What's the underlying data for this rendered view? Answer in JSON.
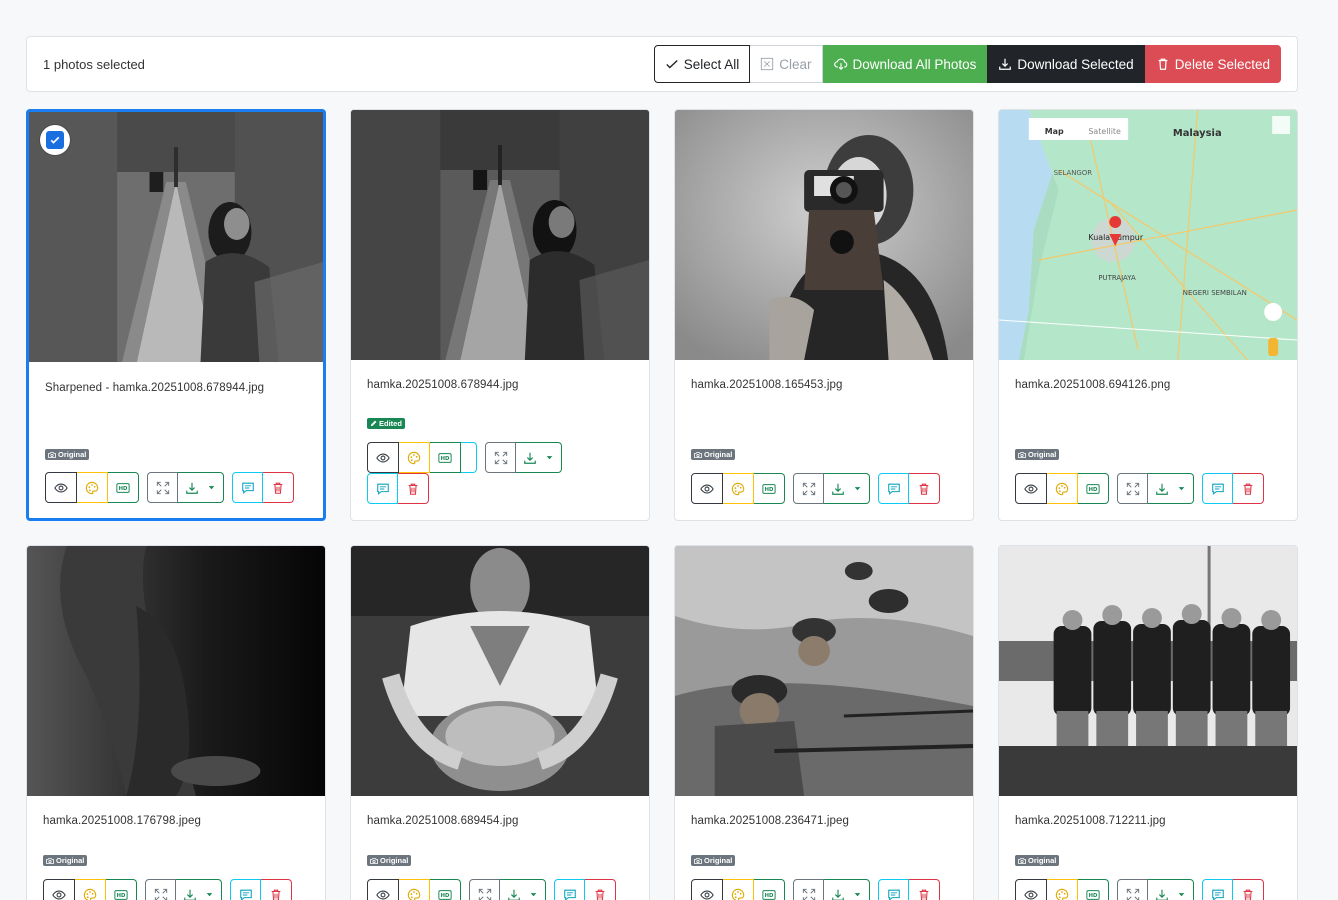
{
  "toolbar": {
    "selected_count": "1 photos selected",
    "select_all_label": "Select All",
    "clear_label": "Clear",
    "download_all_label": "Download All Photos",
    "download_selected_label": "Download Selected",
    "delete_selected_label": "Delete Selected"
  },
  "badges": {
    "original": "Original",
    "edited": "Edited"
  },
  "photos": [
    {
      "filename": "Sharpened - hamka.20251008.678944.jpg",
      "badge": "Original",
      "selected": true
    },
    {
      "filename": "hamka.20251008.678944.jpg",
      "badge": "Edited",
      "selected": false
    },
    {
      "filename": "hamka.20251008.165453.jpg",
      "badge": "Original",
      "selected": false
    },
    {
      "filename": "hamka.20251008.694126.png",
      "badge": "Original",
      "selected": false
    },
    {
      "filename": "hamka.20251008.176798.jpeg",
      "badge": "Original",
      "selected": false
    },
    {
      "filename": "hamka.20251008.689454.jpg",
      "badge": "Original",
      "selected": false
    },
    {
      "filename": "hamka.20251008.236471.jpeg",
      "badge": "Original",
      "selected": false
    },
    {
      "filename": "hamka.20251008.712211.jpg",
      "badge": "Original",
      "selected": false
    }
  ],
  "map": {
    "tab_map": "Map",
    "tab_satellite": "Satellite",
    "country": "Malaysia",
    "region": "SELANGOR",
    "city": "Kuala Lumpur",
    "town": "PUTRAJAYA",
    "state": "NEGERI SEMBILAN"
  },
  "colors": {
    "accent": "#1a7ef2",
    "success": "#4cae4f",
    "dark": "#212529",
    "danger": "#dc4c55"
  }
}
